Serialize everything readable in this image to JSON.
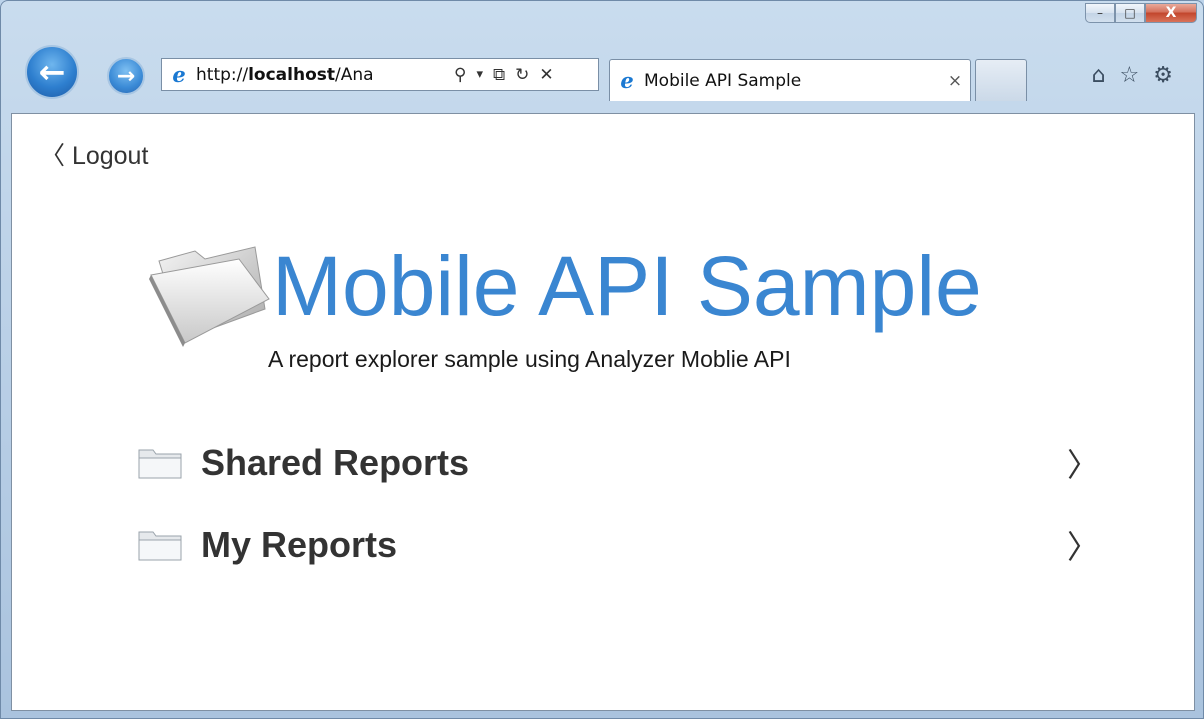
{
  "window": {
    "minimize_glyph": "–",
    "maximize_glyph": "□",
    "close_glyph": "X"
  },
  "browser": {
    "back_glyph": "←",
    "forward_glyph": "→",
    "ie_glyph": "e",
    "url_prefix": "http://",
    "url_host": "localhost",
    "url_rest": "/Ana",
    "search_glyph": "⚲",
    "dropdown_glyph": "▾",
    "compat_glyph": "⧉",
    "refresh_glyph": "↻",
    "stop_glyph": "✕",
    "tab_title": "Mobile API Sample",
    "tab_close_glyph": "×",
    "home_glyph": "⌂",
    "favorites_glyph": "☆",
    "tools_glyph": "⚙"
  },
  "page": {
    "logout_label": "〈 Logout",
    "title": "Mobile API Sample",
    "subtitle": "A report explorer sample using Analyzer Moblie API",
    "items": [
      {
        "label": "Shared Reports",
        "chevron": "〉"
      },
      {
        "label": "My Reports",
        "chevron": "〉"
      }
    ]
  },
  "colors": {
    "title_blue": "#3a86d1",
    "text_dark": "#333333"
  },
  "icons": {
    "logo": "folder-icon",
    "item": "folder-icon"
  }
}
